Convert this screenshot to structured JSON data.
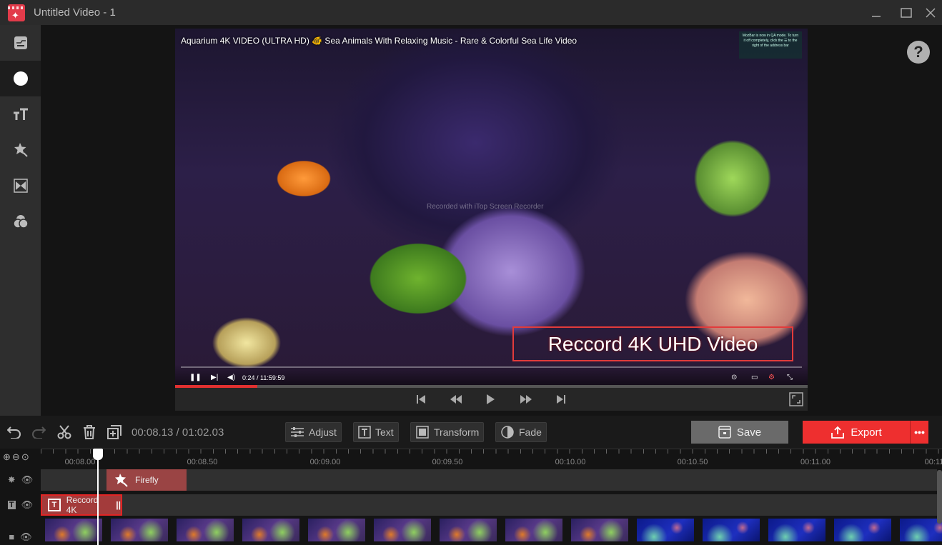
{
  "window": {
    "title": "Untitled Video - 1",
    "minimize": "minimize",
    "maximize": "maximize",
    "close": "close"
  },
  "sidebar": {
    "items": [
      {
        "name": "media",
        "icon": "media-icon",
        "active": false
      },
      {
        "name": "effects",
        "icon": "circle-icon",
        "active": true
      },
      {
        "name": "text",
        "icon": "text-icon",
        "active": false
      },
      {
        "name": "stickers",
        "icon": "magic-star-icon",
        "active": false
      },
      {
        "name": "transitions",
        "icon": "transition-icon",
        "active": false
      },
      {
        "name": "filters",
        "icon": "filter-icon",
        "active": false
      }
    ],
    "toggle": "›"
  },
  "preview": {
    "video_title": "Aquarium 4K VIDEO (ULTRA HD) 🐠 Sea Animals With Relaxing Music - Rare & Colorful Sea Life Video",
    "notification": "MozBar is now in QA mode. To turn it off completely, click the ☰ to the right of the address bar",
    "watermark": "Recorded with iTop Screen Recorder",
    "caption": "Reccord 4K UHD Video",
    "yt_time": "0:24 / 11:59:59",
    "progress_fraction": 0.13,
    "help": "?"
  },
  "toolbar": {
    "timecode": "00:08.13 / 01:02.03",
    "adjust": "Adjust",
    "text": "Text",
    "transform": "Transform",
    "fade": "Fade",
    "save": "Save",
    "export": "Export",
    "more": "•••",
    "accent": "#ee2f2f"
  },
  "timeline": {
    "ticks": [
      "00:08.00",
      "00:08.50",
      "00:09.00",
      "00:09.50",
      "00:10.00",
      "00:10.50",
      "00:11.00",
      "00:11"
    ],
    "effect_clip": "Firefly",
    "text_clip": "Reccord 4K"
  }
}
